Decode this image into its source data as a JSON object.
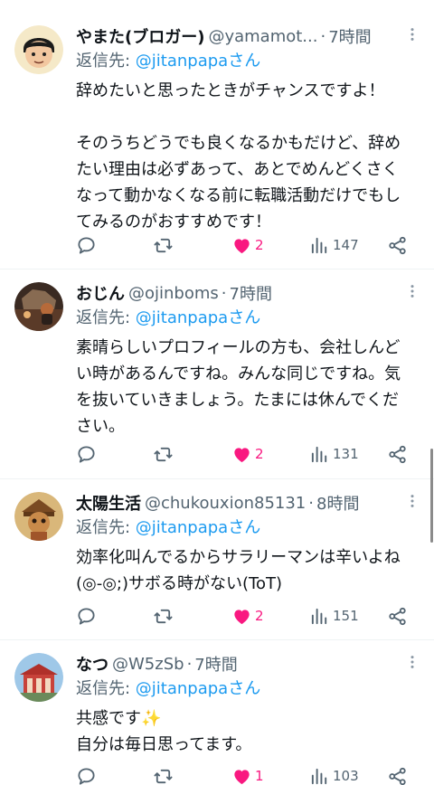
{
  "tweets": [
    {
      "name": "やまた(ブロガー)",
      "handle": "@yamamot...",
      "dot": "·",
      "time": "7時間",
      "reply_prefix": "返信先: ",
      "reply_mention": "@jitanpapaさん",
      "text": "辞めたいと思ったときがチャンスですよ！\n\nそのうちどうでも良くなるかもだけど、辞めたい理由は必ずあって、あとでめんどくさくなって動かなくなる前に転職活動だけでもしてみるのがおすすめです！",
      "replies": "",
      "retweets": "",
      "likes": "2",
      "views": "147"
    },
    {
      "name": "おじん",
      "handle": "@ojinboms",
      "dot": "·",
      "time": "7時間",
      "reply_prefix": "返信先: ",
      "reply_mention": "@jitanpapaさん",
      "text": "素晴らしいプロフィールの方も、会社しんどい時があるんですね。みんな同じですね。気を抜いていきましょう。たまには休んでください。",
      "replies": "",
      "retweets": "",
      "likes": "2",
      "views": "131"
    },
    {
      "name": "太陽生活",
      "handle": "@chukouxion85131",
      "dot": "·",
      "time": "8時間",
      "reply_prefix": "返信先: ",
      "reply_mention": "@jitanpapaさん",
      "text": "効率化叫んでるからサラリーマンは辛いよね(◎-◎;)サボる時がない(ToT)",
      "replies": "",
      "retweets": "",
      "likes": "2",
      "views": "151"
    },
    {
      "name": "なつ",
      "handle": "@W5zSb",
      "dot": "·",
      "time": "7時間",
      "reply_prefix": "返信先: ",
      "reply_mention": "@jitanpapaさん",
      "text": "共感です✨\n自分は毎日思ってます。",
      "replies": "",
      "retweets": "",
      "likes": "1",
      "views": "103"
    }
  ],
  "icons": {
    "reply": "reply-icon",
    "retweet": "retweet-icon",
    "like": "heart-filled-icon",
    "views": "views-chart-icon",
    "share": "share-icon",
    "more": "more-vertical-icon"
  },
  "colors": {
    "like_active": "#f91880",
    "mention": "#1d9bf0",
    "secondary_text": "#536471",
    "primary_text": "#0f1419",
    "divider": "#eff3f4"
  }
}
